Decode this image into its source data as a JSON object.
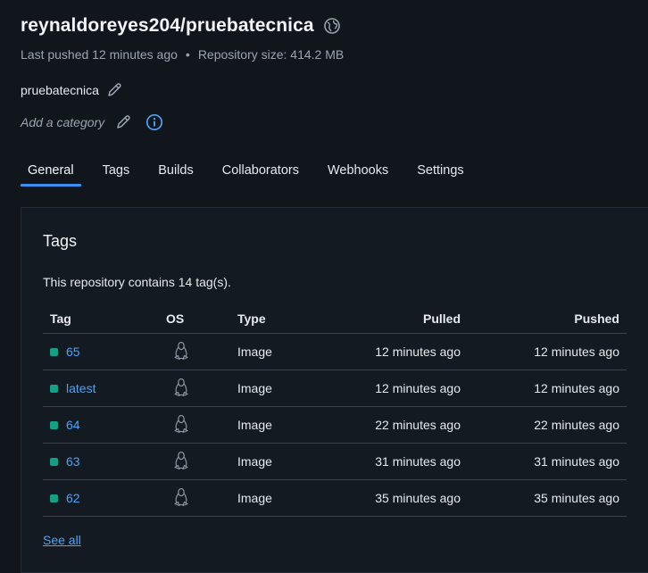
{
  "repo": {
    "title": "reynaldoreyes204/pruebatecnica",
    "last_pushed": "Last pushed 12 minutes ago",
    "separator": "•",
    "size": "Repository size: 414.2 MB",
    "description": "pruebatecnica",
    "category_placeholder": "Add a category"
  },
  "tabs": [
    {
      "label": "General",
      "active": true
    },
    {
      "label": "Tags"
    },
    {
      "label": "Builds"
    },
    {
      "label": "Collaborators"
    },
    {
      "label": "Webhooks"
    },
    {
      "label": "Settings"
    }
  ],
  "tags_panel": {
    "title": "Tags",
    "summary": "This repository contains 14 tag(s).",
    "columns": {
      "tag": "Tag",
      "os": "OS",
      "type": "Type",
      "pulled": "Pulled",
      "pushed": "Pushed"
    },
    "rows": [
      {
        "tag": "65",
        "os_icon": "linux-icon",
        "type": "Image",
        "pulled": "12 minutes ago",
        "pushed": "12 minutes ago"
      },
      {
        "tag": "latest",
        "os_icon": "linux-icon",
        "type": "Image",
        "pulled": "12 minutes ago",
        "pushed": "12 minutes ago"
      },
      {
        "tag": "64",
        "os_icon": "linux-icon",
        "type": "Image",
        "pulled": "22 minutes ago",
        "pushed": "22 minutes ago"
      },
      {
        "tag": "63",
        "os_icon": "linux-icon",
        "type": "Image",
        "pulled": "31 minutes ago",
        "pushed": "31 minutes ago"
      },
      {
        "tag": "62",
        "os_icon": "linux-icon",
        "type": "Image",
        "pulled": "35 minutes ago",
        "pushed": "35 minutes ago"
      }
    ],
    "see_all": "See all"
  },
  "colors": {
    "background": "#11161d",
    "accent": "#3b8ff2",
    "link": "#4ea3f7",
    "tag_status": "#15a085"
  },
  "icons": {
    "visibility": "globe-icon",
    "edit": "pencil-icon",
    "info": "info-icon",
    "os": "linux-icon"
  }
}
